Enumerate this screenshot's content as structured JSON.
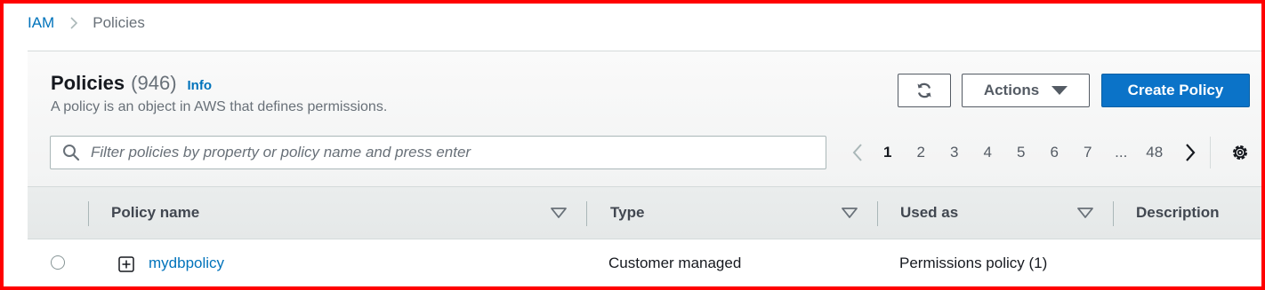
{
  "breadcrumb": {
    "items": [
      {
        "label": "IAM",
        "link": true
      },
      {
        "label": "Policies",
        "link": false
      }
    ]
  },
  "header": {
    "title": "Policies",
    "count": "(946)",
    "info": "Info",
    "subtitle": "A policy is an object in AWS that defines permissions."
  },
  "toolbar": {
    "refresh_icon": "refresh-icon",
    "actions_label": "Actions",
    "create_label": "Create Policy"
  },
  "search": {
    "placeholder": "Filter policies by property or policy name and press enter",
    "value": ""
  },
  "pagination": {
    "pages": [
      "1",
      "2",
      "3",
      "4",
      "5",
      "6",
      "7",
      "...",
      "48"
    ],
    "current": "1"
  },
  "table": {
    "columns": [
      "Policy name",
      "Type",
      "Used as",
      "Description"
    ],
    "rows": [
      {
        "name": "mydbpolicy",
        "type": "Customer managed",
        "used_as": "Permissions policy (1)",
        "description": ""
      }
    ]
  },
  "colors": {
    "accent": "#0073bb",
    "primary_button": "#0b73c8",
    "frame": "#ff0000"
  }
}
